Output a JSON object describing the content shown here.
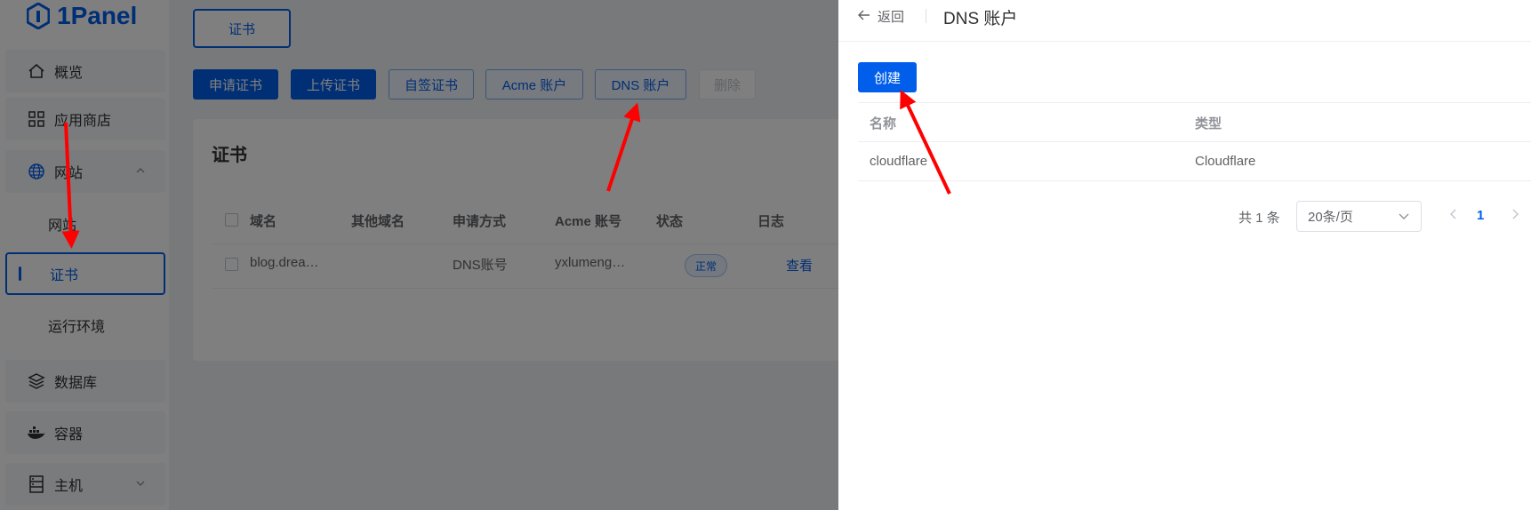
{
  "app": {
    "brand": "1Panel"
  },
  "sidebar": {
    "items": [
      {
        "label": "概览",
        "icon": "home-icon"
      },
      {
        "label": "应用商店",
        "icon": "grid-icon"
      },
      {
        "label": "网站",
        "icon": "globe-icon"
      },
      {
        "label": "数据库",
        "icon": "layers-icon"
      },
      {
        "label": "容器",
        "icon": "docker-icon"
      },
      {
        "label": "主机",
        "icon": "server-icon"
      }
    ],
    "website_sub": [
      {
        "label": "网站"
      },
      {
        "label": "证书"
      },
      {
        "label": "运行环境"
      }
    ]
  },
  "main": {
    "tab": "证书",
    "toolbar": {
      "apply": "申请证书",
      "upload": "上传证书",
      "self_signed": "自签证书",
      "acme": "Acme 账户",
      "dns": "DNS 账户",
      "delete": "删除"
    },
    "card_title": "证书",
    "table": {
      "headers": [
        "域名",
        "其他域名",
        "申请方式",
        "Acme 账号",
        "状态",
        "日志"
      ],
      "rows": [
        {
          "domain": "blog.drea…",
          "other": "",
          "method": "DNS账号",
          "acme": "yxlumeng…",
          "status": "正常",
          "log": "查看"
        }
      ]
    }
  },
  "drawer": {
    "back": "返回",
    "title": "DNS 账户",
    "create": "创建",
    "headers": [
      "名称",
      "类型"
    ],
    "rows": [
      {
        "name": "cloudflare",
        "type": "Cloudflare"
      }
    ],
    "pager": {
      "total": "共 1 条",
      "page_size": "20条/页",
      "current": "1"
    }
  },
  "colors": {
    "accent": "#005eeb",
    "annotation": "#ff0000"
  }
}
